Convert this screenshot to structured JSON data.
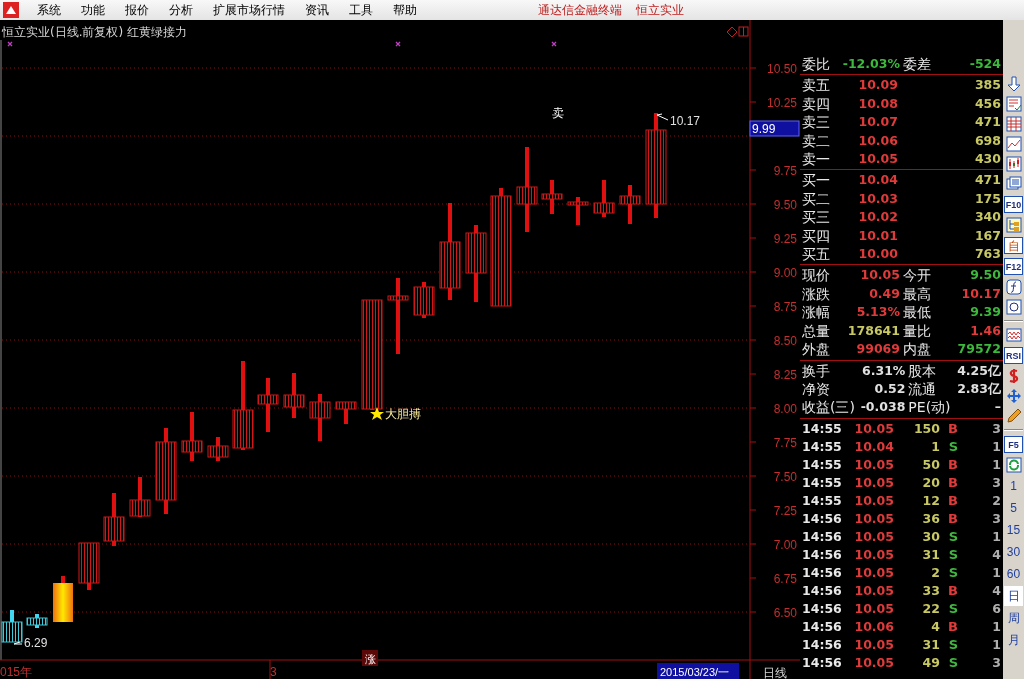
{
  "menu": {
    "items": [
      "系统",
      "功能",
      "报价",
      "分析",
      "扩展市场行情",
      "资讯",
      "工具",
      "帮助"
    ],
    "right_texts": [
      "通达信金融终端",
      "恒立实业"
    ]
  },
  "chart": {
    "title": "恒立实业(日线.前复权) 红黄绿接力",
    "yticks": [
      "10.50",
      "10.25",
      "9.75",
      "9.50",
      "9.25",
      "9.00",
      "8.75",
      "8.50",
      "8.25",
      "8.00",
      "7.75",
      "7.50",
      "7.25",
      "7.00",
      "6.75",
      "6.50"
    ],
    "cursor_price": "9.99",
    "sell_signal": "卖",
    "high_label": "10.17",
    "low_label": "6.29",
    "buy_signal": "大胆搏",
    "bottom_mark": "涨",
    "x_labels": [
      "015年",
      "3"
    ],
    "cursor_date": "2015/03/23/一",
    "period_label": "日线"
  },
  "order_ratio": [
    {
      "label": "委比",
      "value": "-12.03%",
      "color": "#3cb83c"
    },
    {
      "label": "委差",
      "value": "-524",
      "color": "#3cb83c"
    }
  ],
  "asks": [
    {
      "label": "卖五",
      "price": "10.09",
      "volume": "385"
    },
    {
      "label": "卖四",
      "price": "10.08",
      "volume": "456"
    },
    {
      "label": "卖三",
      "price": "10.07",
      "volume": "471"
    },
    {
      "label": "卖二",
      "price": "10.06",
      "volume": "698"
    },
    {
      "label": "卖一",
      "price": "10.05",
      "volume": "430"
    }
  ],
  "bids": [
    {
      "label": "买一",
      "price": "10.04",
      "volume": "471"
    },
    {
      "label": "买二",
      "price": "10.03",
      "volume": "175"
    },
    {
      "label": "买三",
      "price": "10.02",
      "volume": "340"
    },
    {
      "label": "买四",
      "price": "10.01",
      "volume": "167"
    },
    {
      "label": "买五",
      "price": "10.00",
      "volume": "763"
    }
  ],
  "quote": [
    {
      "label": "现价",
      "value": "10.05",
      "color": "#e03a3a"
    },
    {
      "label": "今开",
      "value": "9.50",
      "color": "#3cb83c"
    },
    {
      "label": "涨跌",
      "value": "0.49",
      "color": "#e03a3a"
    },
    {
      "label": "最高",
      "value": "10.17",
      "color": "#e03a3a"
    },
    {
      "label": "涨幅",
      "value": "5.13%",
      "color": "#e03a3a"
    },
    {
      "label": "最低",
      "value": "9.39",
      "color": "#3cb83c"
    },
    {
      "label": "总量",
      "value": "178641",
      "color": "#c8c864"
    },
    {
      "label": "量比",
      "value": "1.46",
      "color": "#e03a3a"
    },
    {
      "label": "外盘",
      "value": "99069",
      "color": "#e03a3a"
    },
    {
      "label": "内盘",
      "value": "79572",
      "color": "#3cb83c"
    }
  ],
  "fundamentals": [
    {
      "label": "换手",
      "value": "6.31%"
    },
    {
      "label": "股本",
      "value": "4.25亿"
    },
    {
      "label": "净资",
      "value": "0.52"
    },
    {
      "label": "流通",
      "value": "2.83亿"
    },
    {
      "label": "收益(三)",
      "value": "-0.038"
    },
    {
      "label": "PE(动)",
      "value": "–"
    }
  ],
  "trades": [
    {
      "time": "14:55",
      "price": "10.05",
      "volume": "150",
      "side": "B",
      "kind": "buy",
      "count": "3"
    },
    {
      "time": "14:55",
      "price": "10.04",
      "volume": "1",
      "side": "S",
      "kind": "sell",
      "count": "1"
    },
    {
      "time": "14:55",
      "price": "10.05",
      "volume": "50",
      "side": "B",
      "kind": "buy",
      "count": "1"
    },
    {
      "time": "14:55",
      "price": "10.05",
      "volume": "20",
      "side": "B",
      "kind": "buy",
      "count": "3"
    },
    {
      "time": "14:55",
      "price": "10.05",
      "volume": "12",
      "side": "B",
      "kind": "buy",
      "count": "2"
    },
    {
      "time": "14:56",
      "price": "10.05",
      "volume": "36",
      "side": "B",
      "kind": "buy",
      "count": "3"
    },
    {
      "time": "14:56",
      "price": "10.05",
      "volume": "30",
      "side": "S",
      "kind": "sell",
      "count": "1"
    },
    {
      "time": "14:56",
      "price": "10.05",
      "volume": "31",
      "side": "S",
      "kind": "sell",
      "count": "4"
    },
    {
      "time": "14:56",
      "price": "10.05",
      "volume": "2",
      "side": "S",
      "kind": "sell",
      "count": "1"
    },
    {
      "time": "14:56",
      "price": "10.05",
      "volume": "33",
      "side": "B",
      "kind": "buy",
      "count": "4"
    },
    {
      "time": "14:56",
      "price": "10.05",
      "volume": "22",
      "side": "S",
      "kind": "sell",
      "count": "6"
    },
    {
      "time": "14:56",
      "price": "10.06",
      "volume": "4",
      "side": "B",
      "kind": "buy",
      "count": "1"
    },
    {
      "time": "14:56",
      "price": "10.05",
      "volume": "31",
      "side": "S",
      "kind": "sell",
      "count": "1"
    },
    {
      "time": "14:56",
      "price": "10.05",
      "volume": "49",
      "side": "S",
      "kind": "sell",
      "count": "3"
    }
  ],
  "toolbar": [
    {
      "kind": "down-arrow"
    },
    {
      "kind": "checklist"
    },
    {
      "kind": "grid"
    },
    {
      "kind": "line-chart"
    },
    {
      "kind": "candles"
    },
    {
      "kind": "windows"
    },
    {
      "kind": "text",
      "label": "F10"
    },
    {
      "kind": "tree"
    },
    {
      "kind": "text",
      "label": "自"
    },
    {
      "kind": "text",
      "label": "F12"
    },
    {
      "kind": "function"
    },
    {
      "kind": "circle"
    },
    {
      "kind": "separator"
    },
    {
      "kind": "wave"
    },
    {
      "kind": "text",
      "label": "RSI"
    },
    {
      "kind": "dollar"
    },
    {
      "kind": "move"
    },
    {
      "kind": "pencil"
    },
    {
      "kind": "separator"
    },
    {
      "kind": "text",
      "label": "F5"
    },
    {
      "kind": "refresh"
    }
  ],
  "periods": [
    {
      "label": "1",
      "selected": false
    },
    {
      "label": "5",
      "selected": false
    },
    {
      "label": "15",
      "selected": false
    },
    {
      "label": "30",
      "selected": false
    },
    {
      "label": "60",
      "selected": false
    },
    {
      "label": "日",
      "selected": true
    },
    {
      "label": "周",
      "selected": false
    },
    {
      "label": "月",
      "selected": false
    }
  ]
}
